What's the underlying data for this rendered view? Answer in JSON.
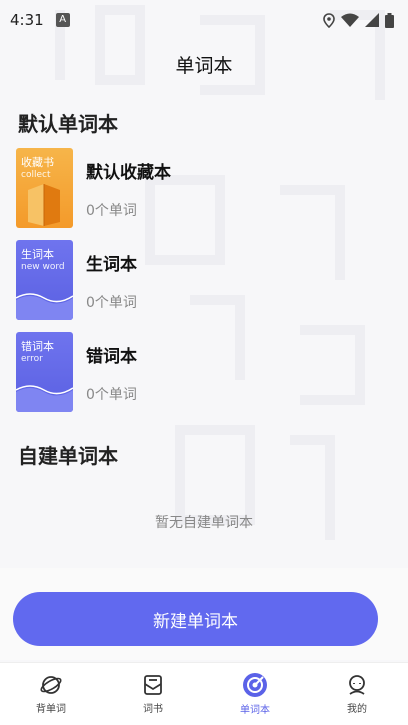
{
  "status_bar": {
    "time": "4:31"
  },
  "header": {
    "title": "单词本"
  },
  "default_section": {
    "title": "默认单词本",
    "books": [
      {
        "name": "默认收藏本",
        "count": "0个单词",
        "cover_title": "收藏书",
        "cover_sub": "collect",
        "cover_color": "#f5a63a"
      },
      {
        "name": "生词本",
        "count": "0个单词",
        "cover_title": "生词本",
        "cover_sub": "new word",
        "cover_color": "#6369ea"
      },
      {
        "name": "错词本",
        "count": "0个单词",
        "cover_title": "错词本",
        "cover_sub": "error",
        "cover_color": "#6369ea"
      }
    ]
  },
  "custom_section": {
    "title": "自建单词本",
    "empty_text": "暂无自建单词本"
  },
  "new_button": {
    "label": "新建单词本",
    "color": "#6169ef"
  },
  "tabs": [
    {
      "label": "背单词",
      "icon": "planet-icon"
    },
    {
      "label": "词书",
      "icon": "book-mail-icon"
    },
    {
      "label": "单词本",
      "icon": "target-icon",
      "active": true
    },
    {
      "label": "我的",
      "icon": "person-icon"
    }
  ]
}
